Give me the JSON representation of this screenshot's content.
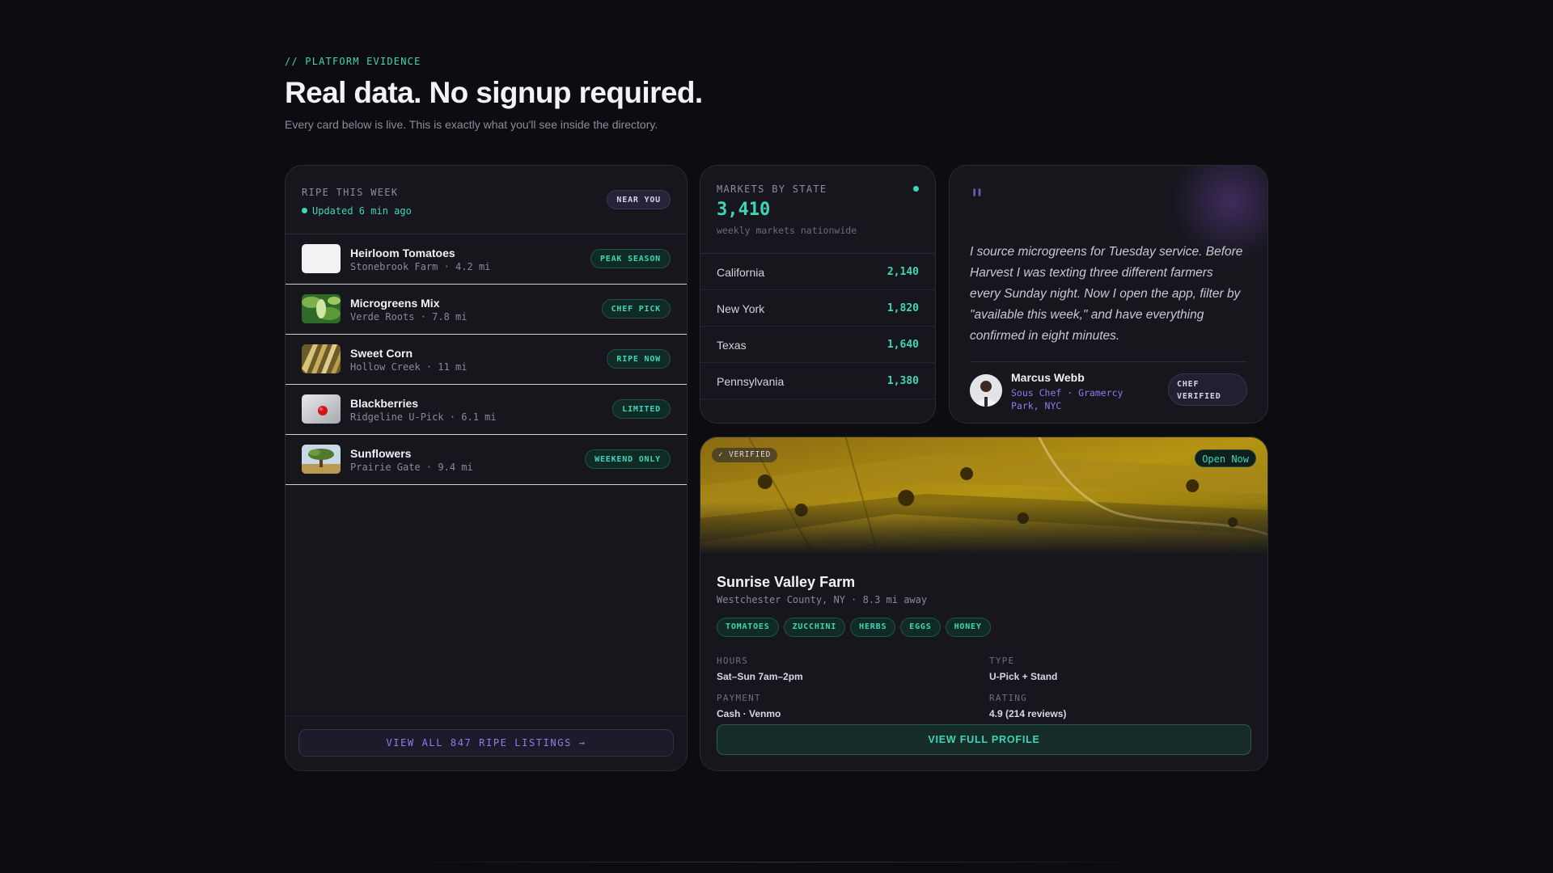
{
  "header": {
    "eyebrow": "// PLATFORM EVIDENCE",
    "title": "Real data. No signup required.",
    "subtitle": "Every card below is live. This is exactly what you'll see inside the directory."
  },
  "ripe": {
    "title": "RIPE THIS WEEK",
    "updated": "Updated 6 min ago",
    "badge": "NEAR YOU",
    "items": [
      {
        "name": "Heirloom Tomatoes",
        "sub": "Stonebrook Farm · 4.2 mi",
        "badge": "PEAK SEASON"
      },
      {
        "name": "Microgreens Mix",
        "sub": "Verde Roots · 7.8 mi",
        "badge": "CHEF PICK"
      },
      {
        "name": "Sweet Corn",
        "sub": "Hollow Creek · 11 mi",
        "badge": "RIPE NOW"
      },
      {
        "name": "Blackberries",
        "sub": "Ridgeline U-Pick · 6.1 mi",
        "badge": "LIMITED"
      },
      {
        "name": "Sunflowers",
        "sub": "Prairie Gate · 9.4 mi",
        "badge": "WEEKEND ONLY"
      }
    ],
    "view_all": "VIEW ALL 847 RIPE LISTINGS →"
  },
  "markets": {
    "title": "MARKETS BY STATE",
    "total": "3,410",
    "caption": "weekly markets nationwide",
    "rows": [
      {
        "state": "California",
        "count": "2,140"
      },
      {
        "state": "New York",
        "count": "1,820"
      },
      {
        "state": "Texas",
        "count": "1,640"
      },
      {
        "state": "Pennsylvania",
        "count": "1,380"
      }
    ]
  },
  "testimonial": {
    "mark": "\"",
    "text": "I source microgreens for Tuesday service. Before Harvest I was texting three different farmers every Sunday night. Now I open the app, filter by \"available this week,\" and have everything confirmed in eight minutes.",
    "name": "Marcus Webb",
    "role": "Sous Chef · Gramercy Park, NYC",
    "badge": "CHEF VERIFIED"
  },
  "farm": {
    "verified": "✓ VERIFIED",
    "status": "Open Now",
    "name": "Sunrise Valley Farm",
    "location": "Westchester County, NY · 8.3 mi away",
    "tags": [
      "TOMATOES",
      "ZUCCHINI",
      "HERBS",
      "EGGS",
      "HONEY"
    ],
    "hours_label": "HOURS",
    "hours": "Sat–Sun 7am–2pm",
    "type_label": "TYPE",
    "type": "U-Pick + Stand",
    "payment_label": "PAYMENT",
    "payment": "Cash · Venmo",
    "rating_label": "RATING",
    "rating": "4.9 (214 reviews)",
    "cta": "VIEW FULL PROFILE"
  },
  "colors": {
    "accent_green": "#3fd6b8",
    "accent_purple": "#8f7cf0",
    "background": "#0d0d11",
    "card": "#16161c"
  }
}
